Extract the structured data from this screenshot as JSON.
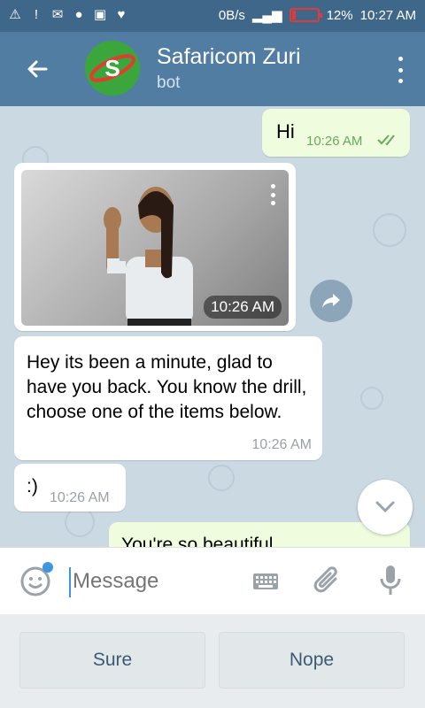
{
  "status_bar": {
    "net_speed": "0B/s",
    "battery": "12%",
    "time": "10:27 AM"
  },
  "header": {
    "title": "Safaricom Zuri",
    "subtitle": "bot",
    "avatar_letter": "S"
  },
  "messages": [
    {
      "direction": "out",
      "text": "Hi",
      "time": "10:26 AM"
    },
    {
      "direction": "in",
      "type": "video",
      "time": "10:26 AM"
    },
    {
      "direction": "in",
      "text": "Hey its been a minute, glad to have you back. You know the drill, choose one of the items below.",
      "time": "10:26 AM"
    },
    {
      "direction": "in",
      "text": ":)",
      "time": "10:26 AM"
    },
    {
      "direction": "out",
      "text": "You're so beautiful"
    }
  ],
  "composer": {
    "placeholder": "Message"
  },
  "bot_keyboard": {
    "buttons": [
      "Sure",
      "Nope"
    ]
  },
  "colors": {
    "header_bg": "#527da3",
    "status_bg": "#3f6789",
    "out_bubble": "#effdde",
    "in_bubble": "#ffffff",
    "accent": "#3d96e0"
  }
}
